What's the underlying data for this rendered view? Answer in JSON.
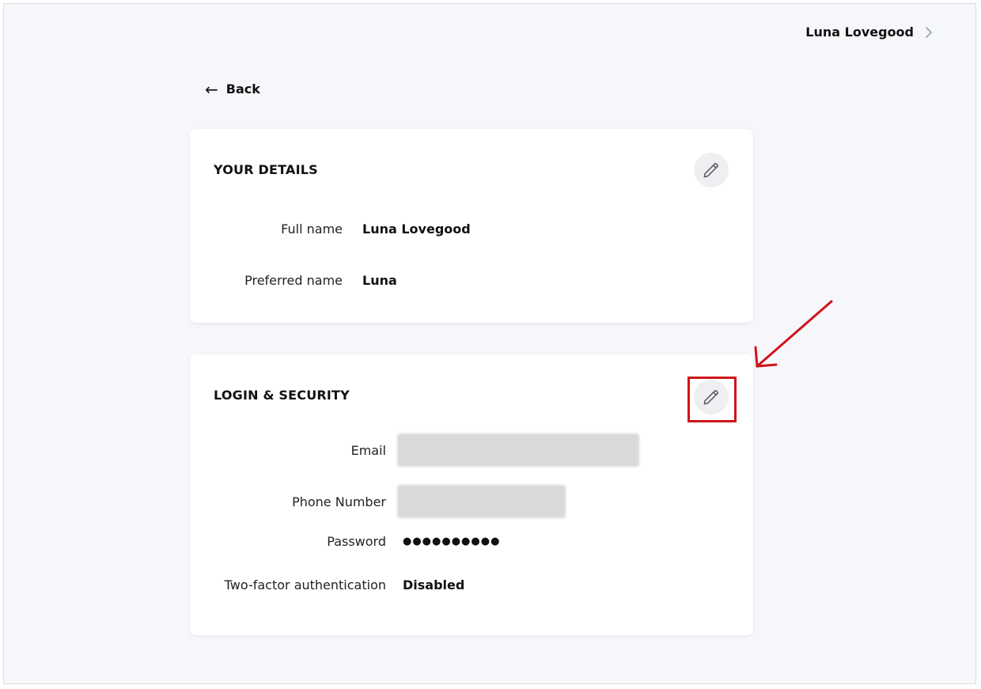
{
  "header": {
    "user_name": "Luna Lovegood"
  },
  "navigation": {
    "back_arrow": "←",
    "back_label": "Back"
  },
  "your_details": {
    "title": "YOUR DETAILS",
    "fields": [
      {
        "label": "Full name",
        "value": "Luna Lovegood"
      },
      {
        "label": "Preferred name",
        "value": "Luna"
      }
    ]
  },
  "login_security": {
    "title": "LOGIN & SECURITY",
    "email_label": "Email",
    "phone_label": "Phone Number",
    "password_label": "Password",
    "password_value": "●●●●●●●●●●",
    "two_factor_label": "Two-factor authentication",
    "two_factor_value": "Disabled"
  },
  "icons": {
    "user_menu": "chevron-right-icon",
    "edit": "pencil-icon",
    "back": "arrow-left-icon"
  },
  "colors": {
    "page_background": "#f6f7fa",
    "card_background": "#ffffff",
    "edit_button_background": "#efeff2",
    "annotation": "#d0141a",
    "redacted": "#dadada"
  }
}
